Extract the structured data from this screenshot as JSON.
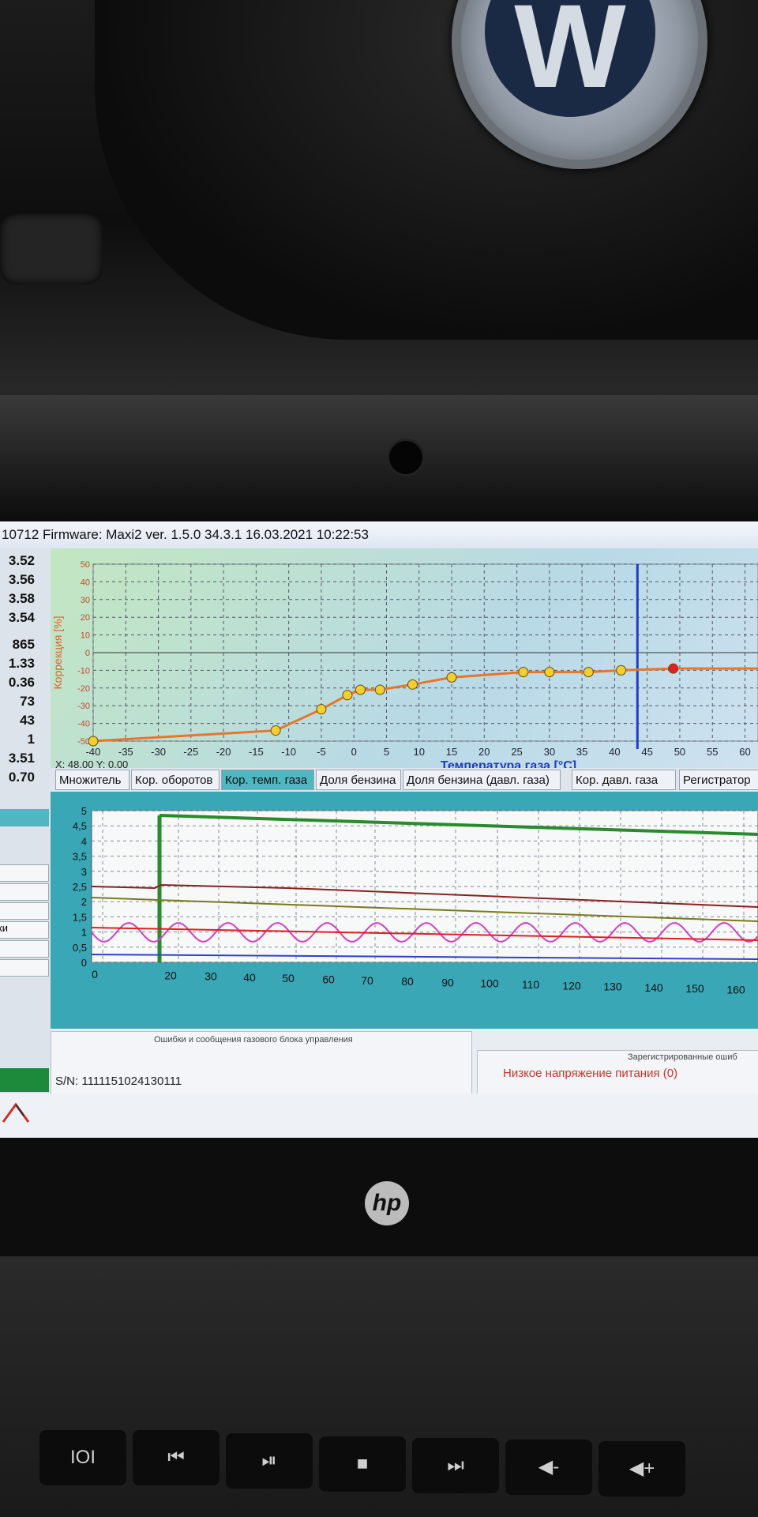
{
  "window": {
    "title": "10712 Firmware: Maxi2  ver. 1.5.0  34.3.1  16.03.2021 10:22:53"
  },
  "left_values": [
    "3.52",
    "3.56",
    "3.58",
    "3.54",
    "865",
    "1.33",
    "0.36",
    "73",
    "43",
    "1",
    "3.51",
    "0.70"
  ],
  "left_fields": [
    "",
    "",
    "",
    "ки",
    "",
    ""
  ],
  "temp_chart": {
    "ylabel": "Коррекция [%]",
    "xlabel": "Температура газа [°C]",
    "cursor": "X: 48,00  Y: 0,00",
    "y_ticks": [
      "50",
      "40",
      "30",
      "20",
      "10",
      "0",
      "-10",
      "-20",
      "-30",
      "-40",
      "-50"
    ],
    "x_ticks": [
      "-40",
      "-35",
      "-30",
      "-25",
      "-20",
      "-15",
      "-10",
      "-5",
      "0",
      "5",
      "10",
      "15",
      "20",
      "25",
      "30",
      "35",
      "40",
      "45",
      "50",
      "55",
      "60"
    ],
    "points": [
      [
        -40,
        -50
      ],
      [
        -12,
        -44
      ],
      [
        -5,
        -32
      ],
      [
        -1,
        -24
      ],
      [
        1,
        -21
      ],
      [
        4,
        -21
      ],
      [
        9,
        -18
      ],
      [
        15,
        -14
      ],
      [
        26,
        -11
      ],
      [
        30,
        -11
      ],
      [
        36,
        -11
      ],
      [
        41,
        -10
      ],
      [
        49,
        -9
      ]
    ],
    "marker_x": 43.5,
    "colors": {
      "line": "#e87528",
      "point": "#f2cf2e",
      "active_point": "#e31e24",
      "marker": "#1d3cc8"
    }
  },
  "tabs": [
    {
      "label": "Множитель",
      "active": false
    },
    {
      "label": "Кор. оборотов",
      "active": false
    },
    {
      "label": "Кор. темп. газа",
      "active": true
    },
    {
      "label": "Доля бензина",
      "active": false
    },
    {
      "label": "Доля бензина (давл. газа)",
      "active": false
    },
    {
      "label": "Кор. давл. газа",
      "active": false
    },
    {
      "label": "Регистратор",
      "active": false
    }
  ],
  "recorder_chart": {
    "y_ticks": [
      "5",
      "4,5",
      "4",
      "3,5",
      "3",
      "2,5",
      "2",
      "1,5",
      "1",
      "0,5",
      "0"
    ],
    "x_ticks": [
      "0",
      "20",
      "30",
      "40",
      "50",
      "60",
      "70",
      "80",
      "90",
      "100",
      "110",
      "120",
      "130",
      "140",
      "150",
      "160"
    ],
    "colors": {
      "green": "#2a8a2e",
      "darkred": "#8a2020",
      "olive": "#7a7a1a",
      "magenta": "#d040c0",
      "red": "#e02020",
      "blue": "#3040d0"
    }
  },
  "messages": {
    "header": "Ошибки и сообщения газового блока управления",
    "registered_header": "Зарегистрированные ошиб",
    "error": "Низкое напряжение питания (0)"
  },
  "status": {
    "serial": "S/N: 1111151024130111"
  },
  "keyboard": {
    "keys": [
      "IOI",
      "⏮",
      "⏯",
      "■",
      "⏭",
      "◀-",
      "◀+"
    ]
  }
}
